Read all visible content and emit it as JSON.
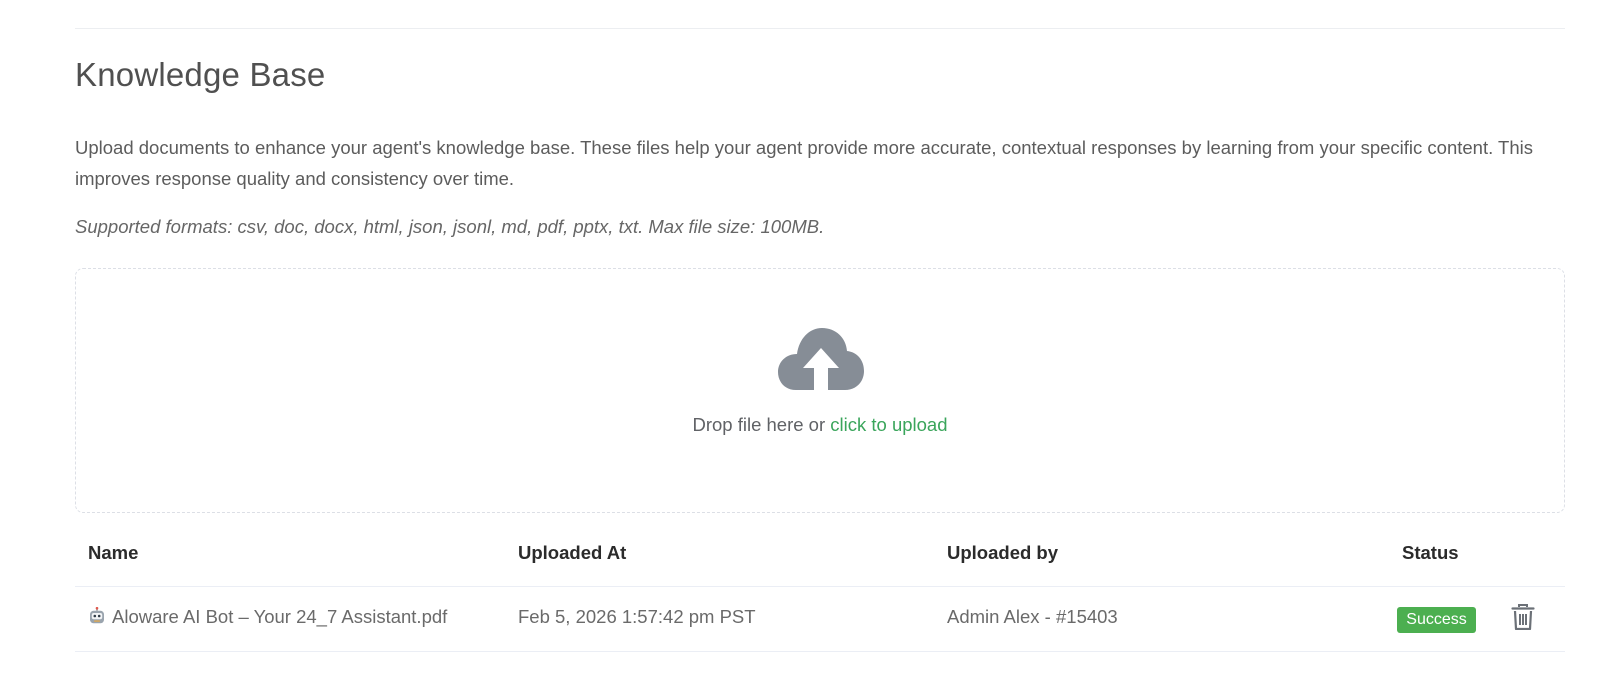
{
  "header": {
    "title": "Knowledge Base",
    "description": "Upload documents to enhance your agent's knowledge base. These files help your agent provide more accurate, contextual responses by learning from your specific content. This improves response quality and consistency over time.",
    "formats": "Supported formats: csv, doc, docx, html, json, jsonl, md, pdf, pptx, txt. Max file size: 100MB."
  },
  "dropzone": {
    "icon": "cloud-upload-icon",
    "prompt": "Drop file here or ",
    "link": "click to upload"
  },
  "table": {
    "columns": [
      "Name",
      "Uploaded At",
      "Uploaded by",
      "Status"
    ],
    "rows": [
      {
        "icon": "robot-icon",
        "name": "Aloware AI Bot – Your 24_7 Assistant.pdf",
        "uploaded_at": "Feb 5, 2026 1:57:42 pm PST",
        "uploaded_by": "Admin Alex - #15403",
        "status": "Success",
        "action_icon": "trash-icon"
      }
    ]
  },
  "colors": {
    "link": "#3aa55b",
    "success": "#4caf50",
    "icon_gray": "#868d96"
  }
}
